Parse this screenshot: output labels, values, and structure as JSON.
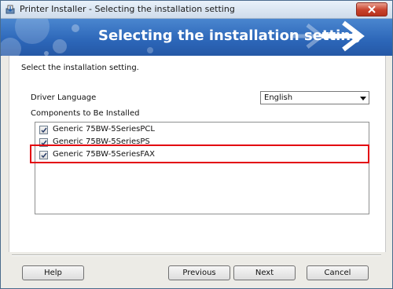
{
  "window": {
    "title": "Printer Installer - Selecting the installation setting"
  },
  "banner": {
    "title": "Selecting the installation setting"
  },
  "main": {
    "instruction": "Select the installation setting.",
    "driver_language": {
      "label": "Driver Language",
      "selected": "English"
    },
    "components": {
      "label": "Components to Be Installed",
      "items": [
        {
          "label": "Generic 75BW-5SeriesPCL",
          "checked": true
        },
        {
          "label": "Generic 75BW-5SeriesPS",
          "checked": true
        },
        {
          "label": "Generic 75BW-5SeriesFAX",
          "checked": true,
          "highlighted": true
        }
      ]
    }
  },
  "buttons": {
    "help": "Help",
    "previous": "Previous",
    "next": "Next",
    "cancel": "Cancel"
  },
  "colors": {
    "highlight": "#e3000f",
    "banner": "#2c66b8"
  }
}
